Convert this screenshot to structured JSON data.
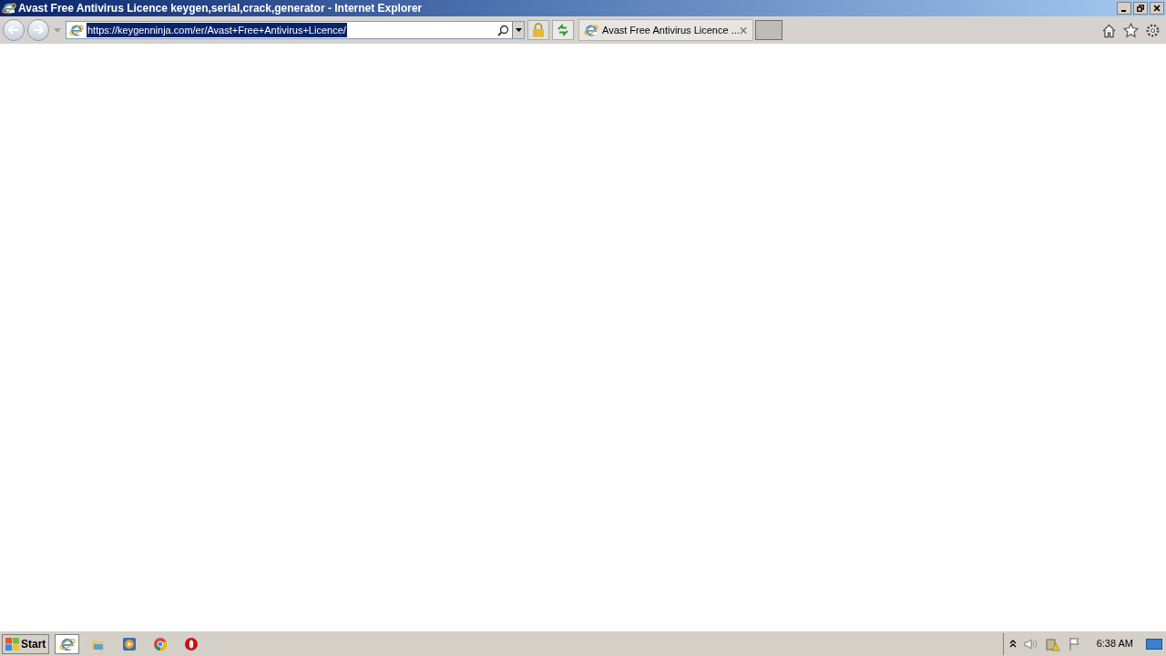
{
  "window": {
    "title": "Avast Free Antivirus Licence keygen,serial,crack,generator - Internet Explorer"
  },
  "address_bar": {
    "url": "https://keygenninja.com/er/Avast+Free+Antivirus+Licence/",
    "selected": true
  },
  "tab": {
    "label": "Avast Free Antivirus Licence ..."
  },
  "taskbar": {
    "start": "Start",
    "apps": [
      {
        "kind": "ie",
        "active": true
      },
      {
        "kind": "folder",
        "active": false
      },
      {
        "kind": "media",
        "active": false
      },
      {
        "kind": "chrome",
        "active": false
      },
      {
        "kind": "opera",
        "active": false
      }
    ],
    "clock": "6:38 AM"
  }
}
